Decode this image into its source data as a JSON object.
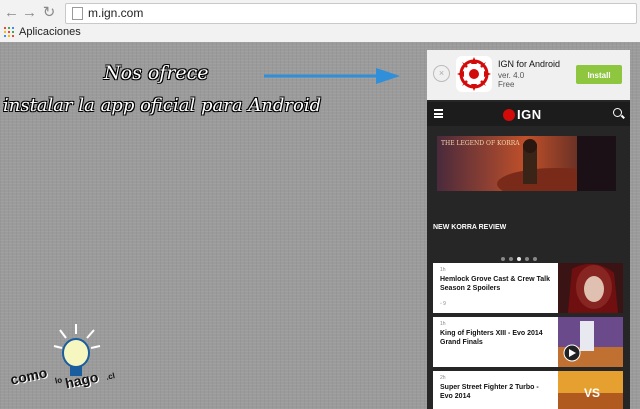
{
  "browser": {
    "url": "m.ign.com",
    "bookmarks_label": "Aplicaciones"
  },
  "annotation": {
    "line1": "Nos ofrece",
    "line2": "instalar la app oficial para Android"
  },
  "logo": {
    "word1": "como",
    "word2": "lo",
    "word3": "hago",
    "suffix": ".cl"
  },
  "app_banner": {
    "name": "IGN for Android",
    "version": "ver. 4.0",
    "price": "Free",
    "install_label": "Install",
    "close_glyph": "×"
  },
  "ign": {
    "logo_text": "IGN",
    "section_title": "NEW KORRA REVIEW",
    "hero_title": "THE LEGEND OF KORRA",
    "carousel_active_index": 2,
    "carousel_count": 5,
    "stories": [
      {
        "time": "1h",
        "headline": "Hemlock Grove Cast & Crew Talk Season 2 Spoilers",
        "comments": "9"
      },
      {
        "time": "1h",
        "headline": "King of Fighters XIII - Evo 2014 Grand Finals",
        "comments": ""
      },
      {
        "time": "2h",
        "headline": "Super Street Fighter 2 Turbo - Evo 2014",
        "comments": ""
      }
    ]
  },
  "colors": {
    "install_green": "#8ec63f",
    "ign_red": "#d20a0a",
    "arrow_blue": "#2f8fd8"
  }
}
